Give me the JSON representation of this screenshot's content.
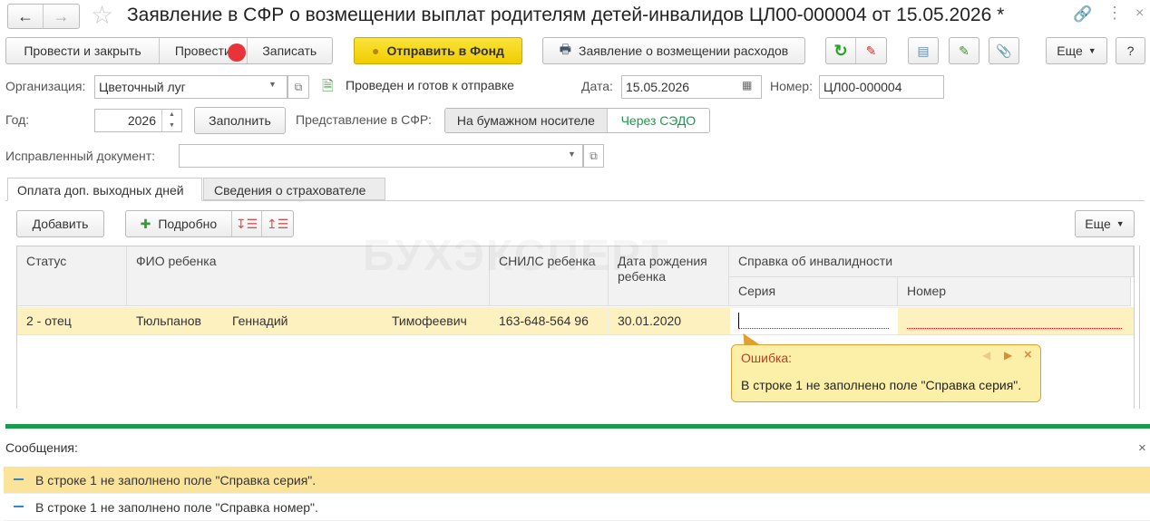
{
  "window": {
    "title": "Заявление в СФР о возмещении выплат родителям детей-инвалидов ЦЛ00-000004 от 15.05.2026 *"
  },
  "toolbar": {
    "post_close": "Провести и закрыть",
    "post": "Провести",
    "save": "Записать",
    "send_fund": "Отправить в Фонд",
    "print_statement": "Заявление о возмещении расходов",
    "more": "Еще",
    "help": "?"
  },
  "header": {
    "org_label": "Организация:",
    "org_value": "Цветочный луг",
    "status_text": "Проведен и готов к отправке",
    "date_label": "Дата:",
    "date_value": "15.05.2026",
    "number_label": "Номер:",
    "number_value": "ЦЛ00-000004",
    "year_label": "Год:",
    "year_value": "2026",
    "fill_button": "Заполнить",
    "submission_label": "Представление в СФР:",
    "submission_options": [
      "На бумажном носителе",
      "Через СЭДО"
    ],
    "corrected_label": "Исправленный документ:",
    "corrected_value": ""
  },
  "tabs": [
    "Оплата доп. выходных дней",
    "Сведения о страхователе"
  ],
  "table_toolbar": {
    "add": "Добавить",
    "details": "Подробно",
    "more": "Еще"
  },
  "watermark": "БУХЭКСПЕРТ",
  "table": {
    "headers": {
      "status": "Статус",
      "fio": "ФИО ребенка",
      "snils": "СНИЛС ребенка",
      "birth": "Дата рождения ребенка",
      "certificate": "Справка об инвалидности",
      "series": "Серия",
      "number": "Номер"
    },
    "rows": [
      {
        "status": "2 - отец",
        "last": "Тюльпанов",
        "first": "Геннадий",
        "middle": "Тимофеевич",
        "snils": "163-648-564 96",
        "birth": "30.01.2020",
        "series": "",
        "number": ""
      }
    ]
  },
  "tooltip": {
    "title": "Ошибка:",
    "text": "В строке 1 не заполнено поле \"Справка серия\"."
  },
  "messages": {
    "title": "Сообщения:",
    "items": [
      "В строке 1 не заполнено поле \"Справка серия\".",
      "В строке 1 не заполнено поле \"Справка номер\"."
    ]
  },
  "colors": {
    "accent_yellow": "#f5d700",
    "row_highlight": "#fdf1c0",
    "error": "#c0392b",
    "green_bar": "#1a9a4c"
  }
}
